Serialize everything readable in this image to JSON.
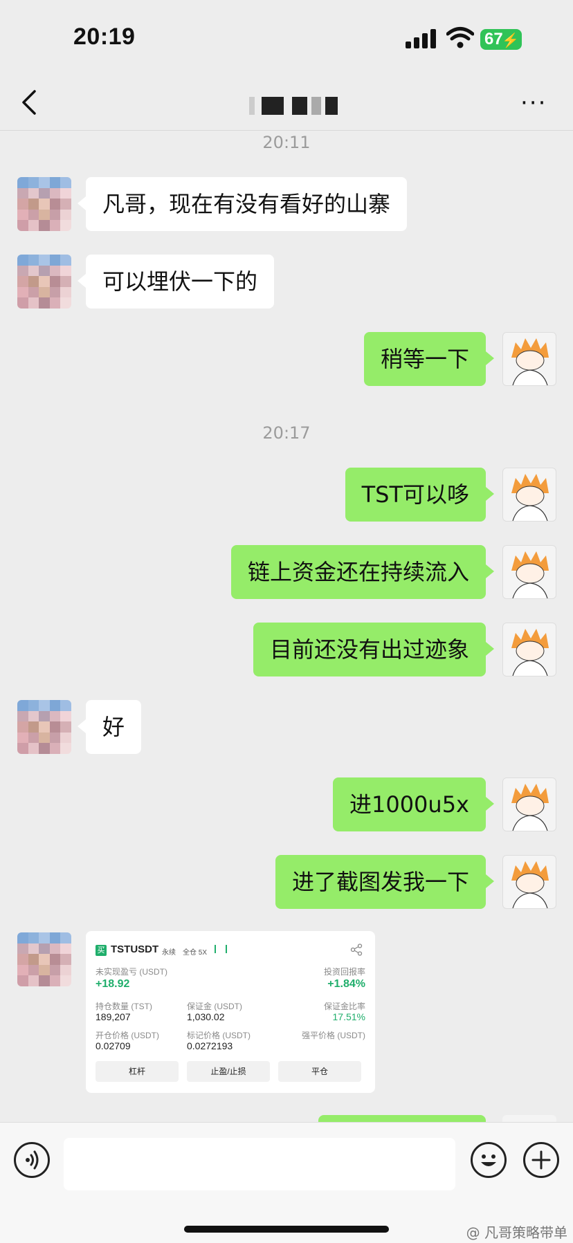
{
  "status_bar": {
    "time": "20:19",
    "battery": "67"
  },
  "nav": {
    "more_label": "···"
  },
  "messages": [
    {
      "type": "time",
      "text": "20:11"
    },
    {
      "type": "in",
      "text": "凡哥，现在有没有看好的山寨"
    },
    {
      "type": "in",
      "text": "可以埋伏一下的"
    },
    {
      "type": "out",
      "text": "稍等一下"
    },
    {
      "type": "time",
      "text": "20:17"
    },
    {
      "type": "out",
      "text": "TST可以哆"
    },
    {
      "type": "out",
      "text": "链上资金还在持续流入"
    },
    {
      "type": "out",
      "text": "目前还没有出过迹象"
    },
    {
      "type": "in",
      "text": "好"
    },
    {
      "type": "out",
      "text": "进1000u5x"
    },
    {
      "type": "out",
      "text": "进了截图发我一下"
    }
  ],
  "card": {
    "buy_badge": "买",
    "symbol": "TSTUSDT",
    "contract": "永续",
    "mode": "全仓 5X",
    "unrealized_label": "未实现盈亏 (USDT)",
    "unrealized_value": "+18.92",
    "roi_label": "投资回报率",
    "roi_value": "+1.84%",
    "qty_label": "持仓数量 (TST)",
    "qty_value": "189,207",
    "margin_label": "保证金 (USDT)",
    "margin_value": "1,030.02",
    "margin_ratio_label": "保证金比率",
    "margin_ratio_value": "17.51%",
    "open_label": "开仓价格 (USDT)",
    "open_value": "0.02709",
    "mark_label": "标记价格 (USDT)",
    "mark_value": "0.0272193",
    "liq_label": "强平价格 (USDT)",
    "btn_leverage": "杠杆",
    "btn_tpsl": "止盈/止损",
    "btn_close": "平仓"
  },
  "watermark": "@ 凡哥策略带单",
  "colors": {
    "bubble_out": "#95ec69",
    "bubble_in": "#ffffff",
    "background": "#ededed",
    "profit": "#1fae6b"
  }
}
